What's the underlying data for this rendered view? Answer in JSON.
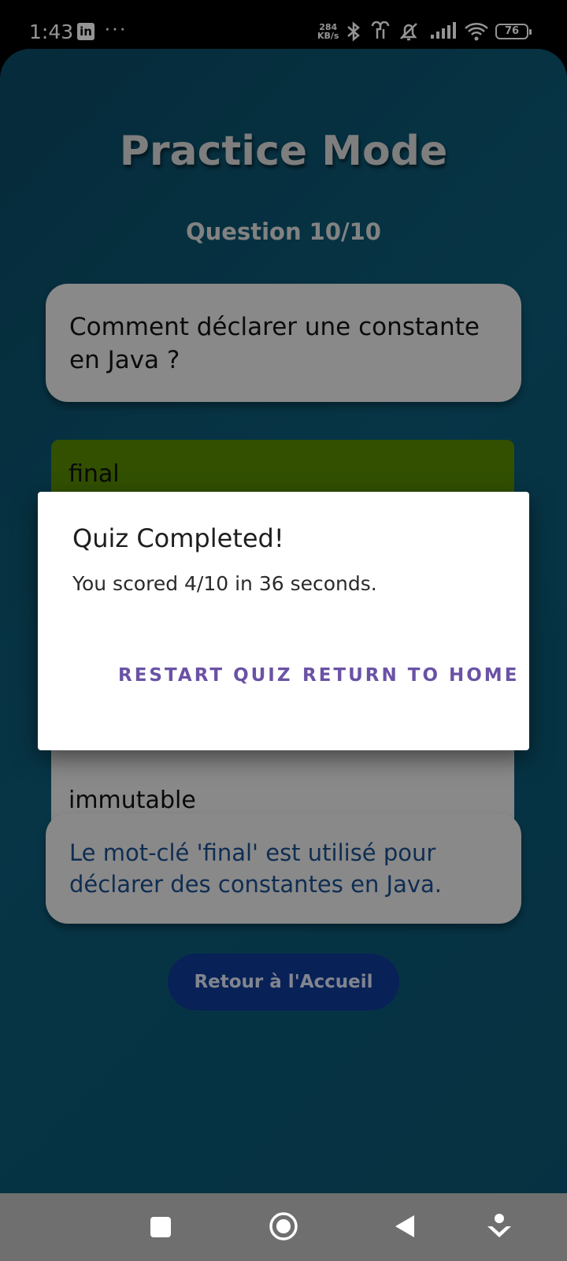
{
  "status_bar": {
    "time": "1:43",
    "notification_app": "in",
    "more_indicator": "···",
    "net_speed_value": "284",
    "net_speed_unit": "KB/s",
    "battery_level": "76",
    "icons": [
      "linkedin-icon",
      "bluetooth-icon",
      "earbuds-icon",
      "silent-icon",
      "signal-icon",
      "wifi-icon",
      "battery-icon"
    ]
  },
  "app": {
    "title": "Practice Mode",
    "question_counter": "Question 10/10",
    "question": "Comment déclarer une constante en Java ?",
    "options": [
      {
        "label": "final",
        "state": "correct",
        "color": "#578a00"
      },
      {
        "label": "immutable",
        "state": "neutral",
        "color": "#ececec"
      }
    ],
    "explanation": "Le mot-clé 'final' est utilisé pour déclarer des constantes en Java.",
    "home_button": "Retour à l'Accueil"
  },
  "dialog": {
    "title": "Quiz Completed!",
    "message": "You scored 4/10 in 36 seconds.",
    "restart_label": "Restart Quiz",
    "home_label": "Return to Home"
  },
  "nav_bar": {
    "icons": [
      "recents-icon",
      "home-icon",
      "back-icon",
      "assistant-icon"
    ]
  },
  "colors": {
    "background": "#0d5c79",
    "accent": "#6a52a5",
    "correct": "#578a00",
    "button": "#0e3a96"
  }
}
